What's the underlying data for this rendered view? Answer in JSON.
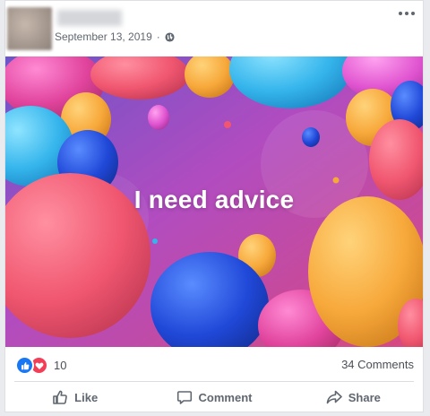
{
  "post": {
    "date": "September 13, 2019",
    "audience_icon": "globe-icon",
    "image_text": "I need advice"
  },
  "stats": {
    "reaction_count": "10",
    "reaction_icons": [
      "like-icon",
      "love-icon"
    ],
    "comments": "34 Comments"
  },
  "actions": {
    "like": "Like",
    "comment": "Comment",
    "share": "Share"
  },
  "colors": {
    "like_blue": "#1877f2",
    "love_red": "#f33e58",
    "text_gray": "#606770"
  }
}
